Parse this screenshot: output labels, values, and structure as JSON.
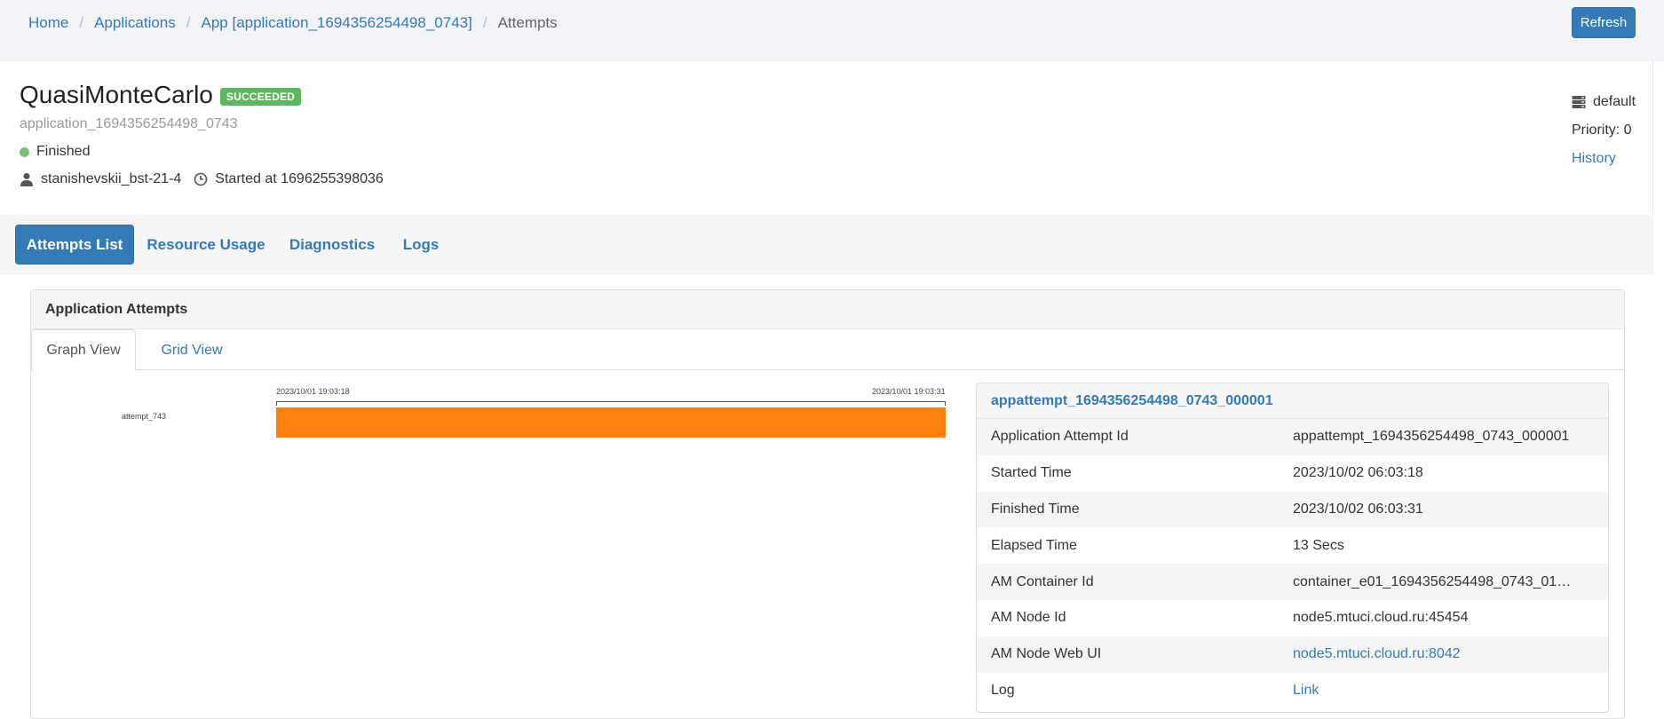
{
  "breadcrumb": {
    "items": [
      "Home",
      "Applications",
      "App [application_1694356254498_0743]"
    ],
    "current": "Attempts",
    "separator": "/"
  },
  "toolbar": {
    "refresh_label": "Refresh"
  },
  "app": {
    "name": "QuasiMonteCarlo",
    "status_badge": "SUCCEEDED",
    "id": "application_1694356254498_0743",
    "state": "Finished",
    "user": "stanishevskii_bst-21-4",
    "started": "Started at 1696255398036",
    "queue": "default",
    "priority": "Priority: 0",
    "history_link": "History"
  },
  "tabs": [
    {
      "label": "Attempts List",
      "active": true
    },
    {
      "label": "Resource Usage",
      "active": false
    },
    {
      "label": "Diagnostics",
      "active": false
    },
    {
      "label": "Logs",
      "active": false
    }
  ],
  "panel": {
    "title": "Application Attempts",
    "subtabs": [
      "Graph View",
      "Grid View"
    ]
  },
  "timeline": {
    "start_label": "2023/10/01 19:03:18",
    "end_label": "2023/10/01 19:03:31",
    "row_label": "attempt_743"
  },
  "attempt": {
    "title": "appattempt_1694356254498_0743_000001",
    "fields": [
      {
        "label": "Application Attempt Id",
        "value": "appattempt_1694356254498_0743_000001",
        "link": false
      },
      {
        "label": "Started Time",
        "value": "2023/10/02 06:03:18",
        "link": false
      },
      {
        "label": "Finished Time",
        "value": "2023/10/02 06:03:31",
        "link": false
      },
      {
        "label": "Elapsed Time",
        "value": "13 Secs",
        "link": false
      },
      {
        "label": "AM Container Id",
        "value": "container_e01_1694356254498_0743_01_…",
        "link": false
      },
      {
        "label": "AM Node Id",
        "value": "node5.mtuci.cloud.ru:45454",
        "link": false
      },
      {
        "label": "AM Node Web UI",
        "value": "node5.mtuci.cloud.ru:8042",
        "link": true
      },
      {
        "label": "Log",
        "value": "Link",
        "link": true
      }
    ]
  },
  "colors": {
    "primary": "#337ab7",
    "success": "#5cb85c",
    "bar": "#ff7f0e",
    "topbar_bg": "#f1f3f7"
  },
  "icons": {
    "user": "user-icon",
    "clock": "clock-icon",
    "queue": "server-stack-icon",
    "state": "status-dot-icon"
  }
}
